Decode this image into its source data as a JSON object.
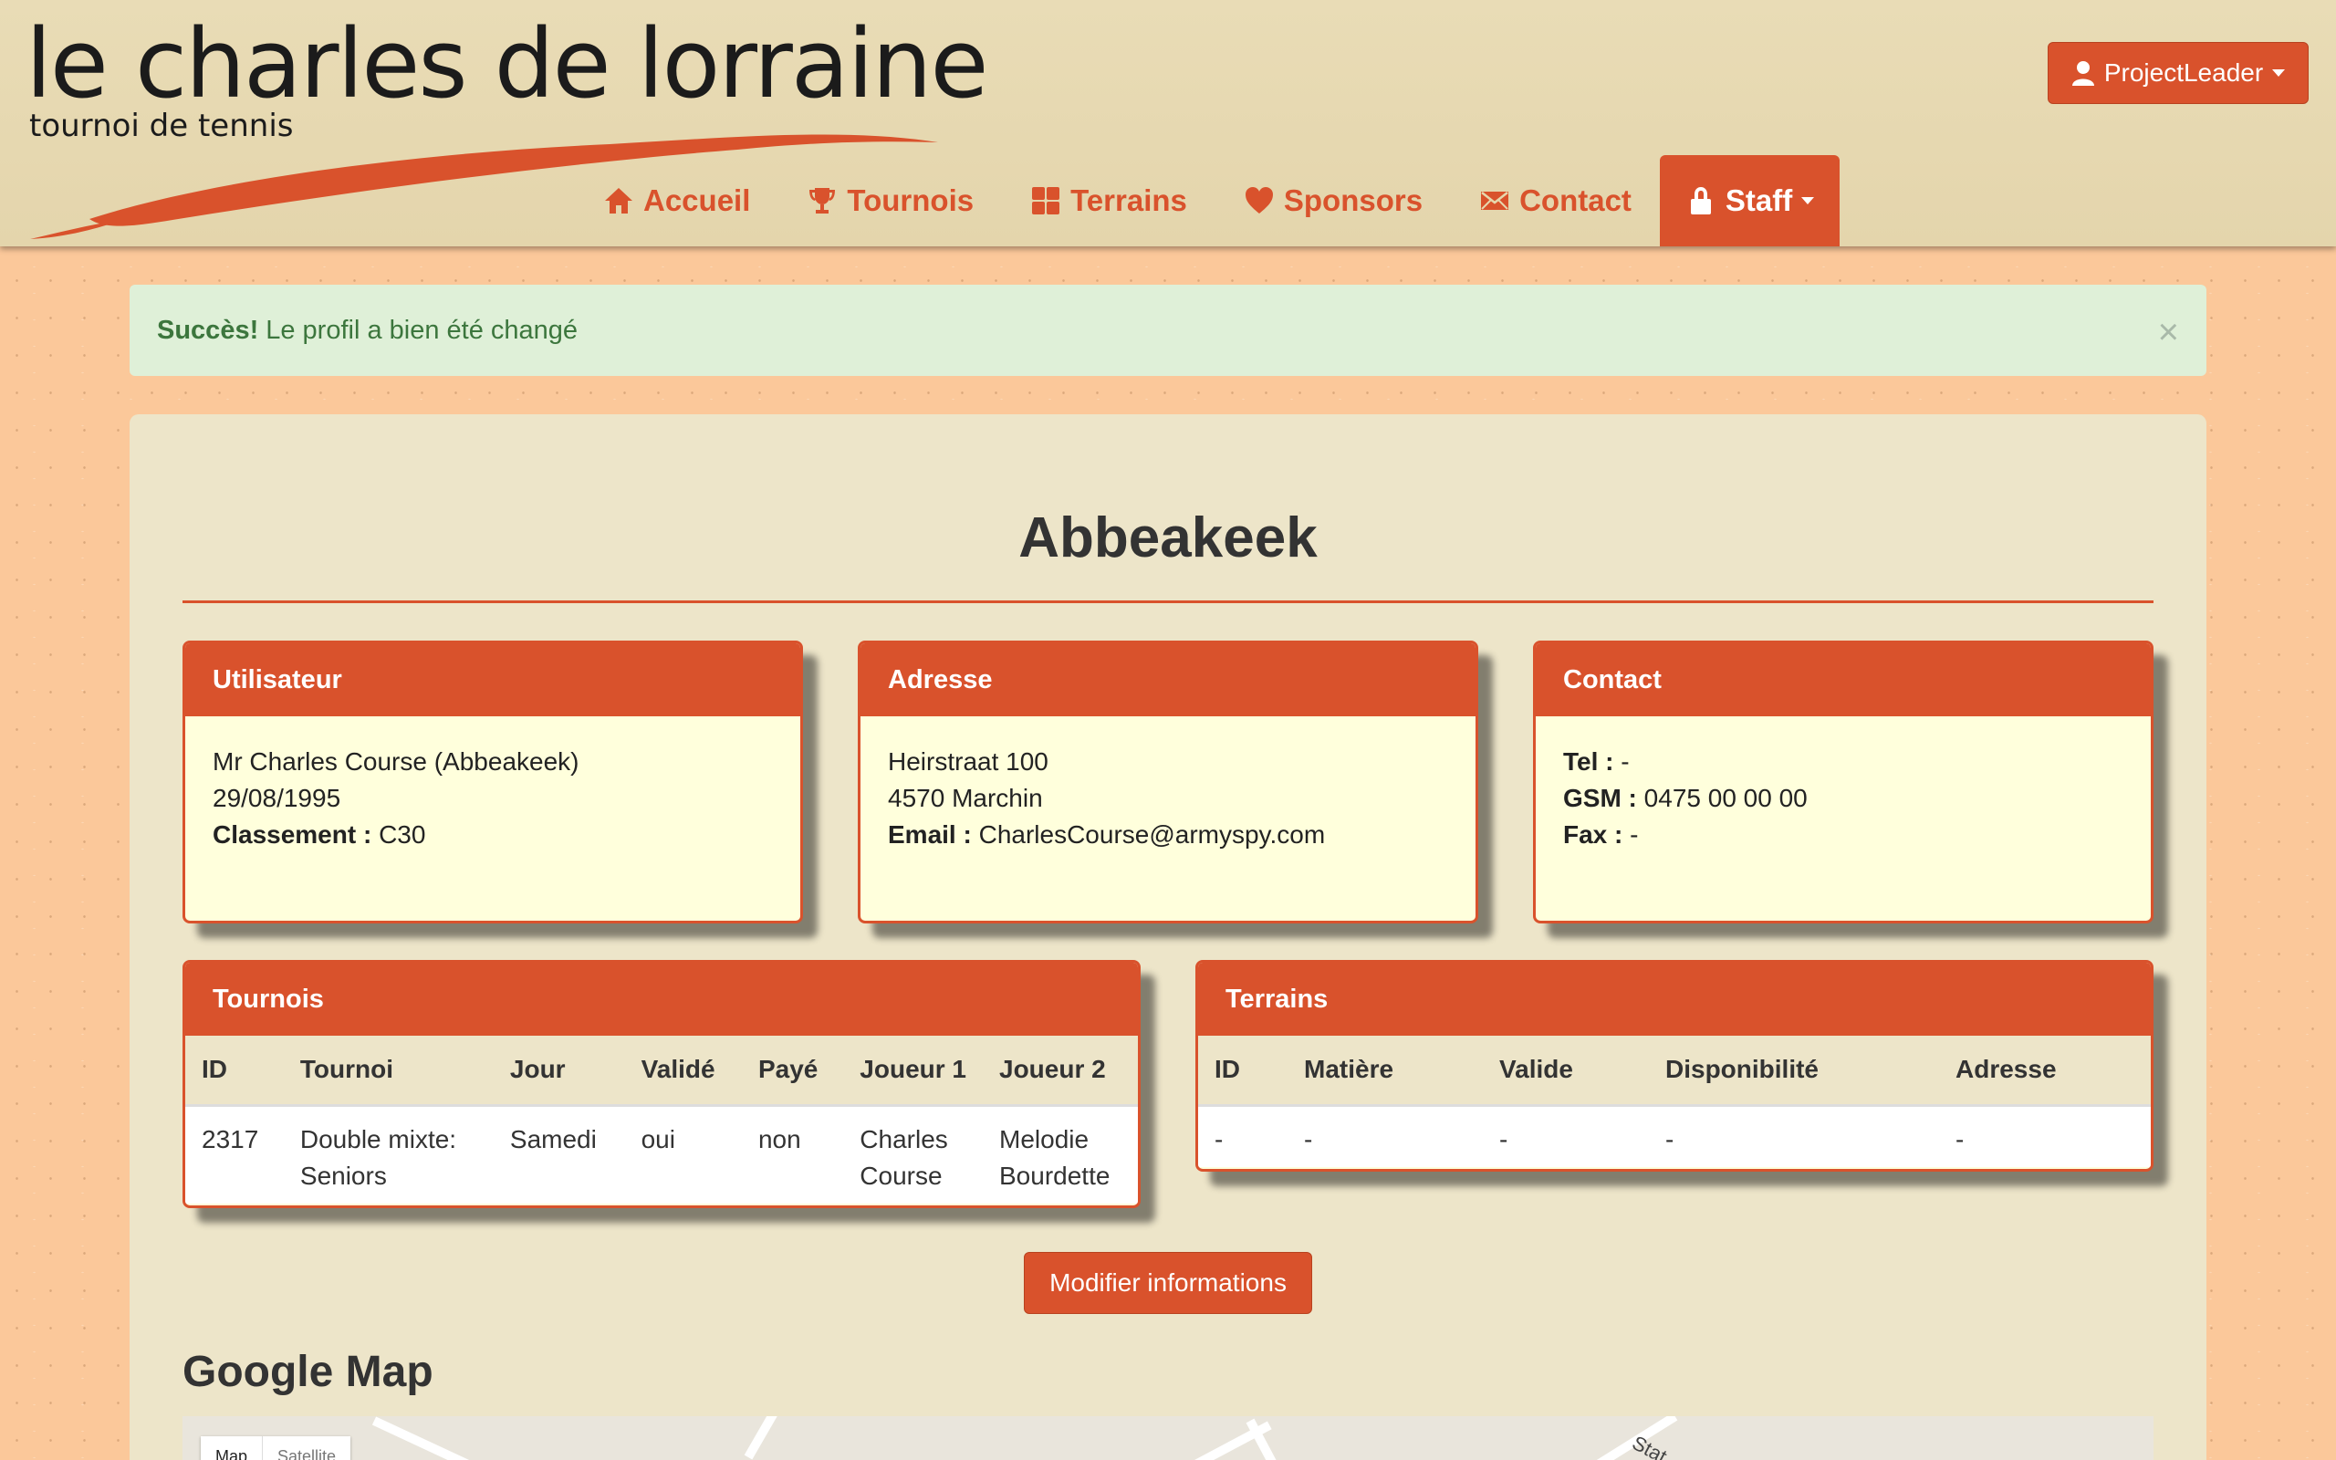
{
  "logo": {
    "title": "le charles de lorraine",
    "subtitle": "tournoi de tennis"
  },
  "user_menu": {
    "label": "ProjectLeader"
  },
  "nav": {
    "items": [
      {
        "label": "Accueil",
        "icon": "home-icon"
      },
      {
        "label": "Tournois",
        "icon": "trophy-icon"
      },
      {
        "label": "Terrains",
        "icon": "grid-icon"
      },
      {
        "label": "Sponsors",
        "icon": "heart-icon"
      },
      {
        "label": "Contact",
        "icon": "envelope-icon"
      },
      {
        "label": "Staff",
        "icon": "lock-icon",
        "active": true
      }
    ]
  },
  "alert": {
    "strong": "Succès!",
    "message": "Le profil a bien été changé",
    "close": "×"
  },
  "profile": {
    "title": "Abbeakeek"
  },
  "utilisateur": {
    "heading": "Utilisateur",
    "name": "Mr Charles Course (Abbeakeek)",
    "birthdate": "29/08/1995",
    "classement_label": "Classement :",
    "classement_value": "C30"
  },
  "adresse": {
    "heading": "Adresse",
    "street": "Heirstraat 100",
    "city": "4570 Marchin",
    "email_label": "Email :",
    "email_value": "CharlesCourse@armyspy.com"
  },
  "contact": {
    "heading": "Contact",
    "tel_label": "Tel :",
    "tel_value": "-",
    "gsm_label": "GSM :",
    "gsm_value": "0475 00 00 00",
    "fax_label": "Fax :",
    "fax_value": "-"
  },
  "tournois": {
    "heading": "Tournois",
    "columns": [
      "ID",
      "Tournoi",
      "Jour",
      "Validé",
      "Payé",
      "Joueur 1",
      "Joueur 2"
    ],
    "rows": [
      [
        "2317",
        "Double mixte: Seniors",
        "Samedi",
        "oui",
        "non",
        "Charles Course",
        "Melodie Bourdette"
      ]
    ]
  },
  "terrains": {
    "heading": "Terrains",
    "columns": [
      "ID",
      "Matière",
      "Valide",
      "Disponibilité",
      "Adresse"
    ],
    "rows": [
      [
        "-",
        "-",
        "-",
        "-",
        "-"
      ]
    ]
  },
  "actions": {
    "modify_label": "Modifier informations"
  },
  "map": {
    "heading": "Google Map",
    "type_map": "Map",
    "type_satellite": "Satellite",
    "street_label": "Stat"
  },
  "colors": {
    "accent": "#d9522c",
    "panel": "#ede5c9",
    "card_body": "#ffffdc",
    "alert_bg": "#dff0d8",
    "alert_text": "#3c763d"
  }
}
